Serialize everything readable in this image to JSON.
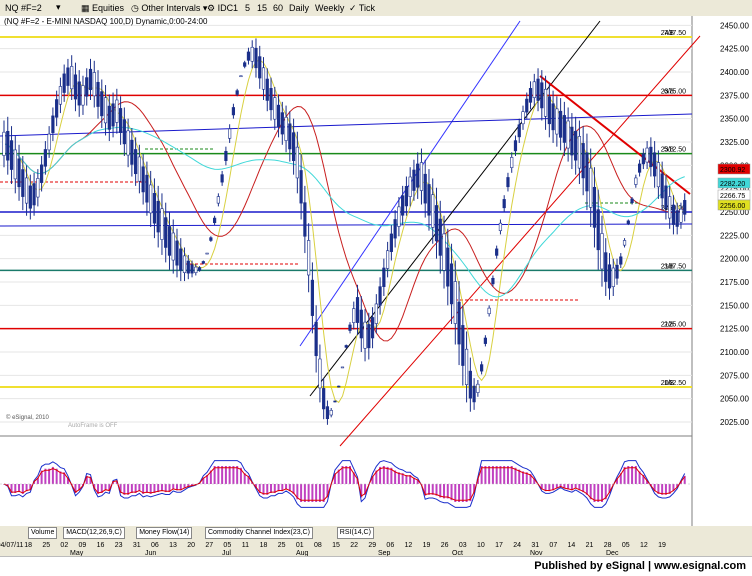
{
  "toolbar": {
    "symbol": "NQ #F=2",
    "equities": "Equities",
    "other_intervals": "Other Intervals",
    "idc": "IDC",
    "i1": "1",
    "i5": "5",
    "i15": "15",
    "i60": "60",
    "daily": "Daily",
    "weekly": "Weekly",
    "tick": "Tick"
  },
  "chart_title": "(NQ #F=2 - E-MINI NASDAQ 100,D) Dynamic,0:00-24:00",
  "watermarks": {
    "copyright": "© eSignal, 2010",
    "autoframe": "AutoFrame is OFF"
  },
  "footer": {
    "brand": "Published by eSignal | www.esignal.com"
  },
  "tabs": [
    "Volume",
    "MACD(12,26,9,C)",
    "Money Flow(14)",
    "Commodity Channel Index(23,C)",
    "RSI(14,C)"
  ],
  "colors": {
    "bg": "#ffffff",
    "candle": "#1a2f8a",
    "fib_red": "#e00000",
    "fib_yellow": "#f0e030",
    "fib_green": "#1a8a1a",
    "fib_blue": "#1a1acc",
    "fib_teal": "#1a7a6a",
    "ma_red": "#c81e1e",
    "ma_yellow": "#d8d040",
    "ma_cyan": "#40d8d8"
  },
  "chart_data": {
    "type": "candlestick",
    "title": "E-MINI NASDAQ 100",
    "y_ticks": [
      2025,
      2050,
      2075,
      2100,
      2125,
      2150,
      2175,
      2200,
      2225,
      2250,
      2275,
      2300,
      2325,
      2350,
      2375,
      2400,
      2425,
      2450
    ],
    "ylim": [
      2010,
      2460
    ],
    "fib_levels": [
      {
        "label": "7/8",
        "value": 2437.5,
        "color": "yellow"
      },
      {
        "label": "6/8",
        "value": 2375.0,
        "color": "red"
      },
      {
        "label": "5/8",
        "value": 2312.5,
        "color": "green"
      },
      {
        "label": "4/8",
        "value": 2250.0,
        "color": "blue"
      },
      {
        "label": "3/8",
        "value": 2187.5,
        "color": "teal"
      },
      {
        "label": "2/8",
        "value": 2125.0,
        "color": "red"
      },
      {
        "label": "1/8",
        "value": 2062.5,
        "color": "yellow"
      }
    ],
    "price_badges": [
      {
        "value": "2300.92",
        "color": "#e00000"
      },
      {
        "value": "2282.20",
        "color": "#40d8d8"
      },
      {
        "value": "2266.75",
        "color": "#ffffff"
      },
      {
        "value": "2256.00",
        "color": "#e0e020"
      }
    ],
    "x_labels": [
      "04/07/11",
      "18",
      "25",
      "02",
      "09",
      "16",
      "23",
      "31",
      "06",
      "13",
      "20",
      "27",
      "05",
      "11",
      "18",
      "25",
      "01",
      "08",
      "15",
      "22",
      "29",
      "06",
      "12",
      "19",
      "26",
      "03",
      "10",
      "17",
      "24",
      "31",
      "07",
      "14",
      "21",
      "28",
      "05",
      "12",
      "19"
    ],
    "month_labels": [
      "May",
      "Jun",
      "Jul",
      "Aug",
      "Sep",
      "Oct",
      "Nov",
      "Dec"
    ],
    "candles_high": [
      2348,
      2352,
      2342,
      2332,
      2322,
      2310,
      2300,
      2290,
      2292,
      2296,
      2310,
      2326,
      2342,
      2362,
      2380,
      2394,
      2408,
      2414,
      2418,
      2410,
      2402,
      2396,
      2404,
      2414,
      2412,
      2402,
      2392,
      2386,
      2376,
      2378,
      2382,
      2374,
      2362,
      2350,
      2340,
      2330,
      2322,
      2312,
      2304,
      2294,
      2286,
      2278,
      2270,
      2260,
      2250,
      2242,
      2232,
      2222,
      2212,
      2204,
      2198,
      2194,
      2192,
      2198,
      2206,
      2218,
      2236,
      2256,
      2278,
      2300,
      2324,
      2350,
      2374,
      2396,
      2412,
      2426,
      2434,
      2436,
      2428,
      2416,
      2404,
      2394,
      2384,
      2376,
      2368,
      2364,
      2358,
      2350,
      2336,
      2312,
      2278,
      2238,
      2196,
      2150,
      2108,
      2072,
      2048,
      2040,
      2048,
      2062,
      2084,
      2108,
      2132,
      2154,
      2172,
      2160,
      2146,
      2142,
      2148,
      2162,
      2180,
      2200,
      2218,
      2236,
      2252,
      2266,
      2278,
      2288,
      2298,
      2306,
      2314,
      2318,
      2306,
      2296,
      2286,
      2276,
      2262,
      2246,
      2232,
      2216,
      2198,
      2176,
      2150,
      2122,
      2094,
      2072,
      2070,
      2090,
      2118,
      2150,
      2182,
      2214,
      2242,
      2268,
      2292,
      2314,
      2332,
      2350,
      2364,
      2378,
      2390,
      2398,
      2404,
      2402,
      2396,
      2388,
      2380,
      2374,
      2372,
      2368,
      2362,
      2356,
      2352,
      2348,
      2342,
      2334,
      2318,
      2298,
      2274,
      2246,
      2222,
      2206,
      2200,
      2200,
      2206,
      2222,
      2242,
      2266,
      2290,
      2306,
      2318,
      2326,
      2330,
      2326,
      2316,
      2304,
      2290,
      2278,
      2268,
      2260,
      2260,
      2270
    ],
    "candles_low": [
      2298,
      2290,
      2280,
      2270,
      2262,
      2252,
      2246,
      2242,
      2246,
      2256,
      2272,
      2290,
      2308,
      2326,
      2342,
      2356,
      2368,
      2376,
      2370,
      2358,
      2352,
      2354,
      2364,
      2370,
      2362,
      2350,
      2340,
      2332,
      2326,
      2330,
      2334,
      2322,
      2310,
      2298,
      2288,
      2278,
      2270,
      2258,
      2246,
      2234,
      2222,
      2212,
      2204,
      2196,
      2188,
      2184,
      2180,
      2176,
      2176,
      2178,
      2180,
      2182,
      2186,
      2194,
      2206,
      2224,
      2246,
      2270,
      2294,
      2320,
      2344,
      2366,
      2382,
      2396,
      2404,
      2408,
      2404,
      2394,
      2382,
      2370,
      2358,
      2348,
      2338,
      2330,
      2322,
      2314,
      2304,
      2290,
      2270,
      2242,
      2206,
      2164,
      2120,
      2078,
      2046,
      2028,
      2022,
      2030,
      2046,
      2064,
      2084,
      2104,
      2120,
      2124,
      2118,
      2100,
      2090,
      2092,
      2104,
      2120,
      2140,
      2160,
      2180,
      2198,
      2212,
      2224,
      2236,
      2246,
      2256,
      2262,
      2264,
      2258,
      2244,
      2230,
      2216,
      2200,
      2184,
      2168,
      2150,
      2130,
      2108,
      2086,
      2064,
      2046,
      2036,
      2038,
      2052,
      2076,
      2106,
      2138,
      2170,
      2200,
      2226,
      2250,
      2272,
      2292,
      2310,
      2324,
      2338,
      2350,
      2360,
      2364,
      2358,
      2348,
      2338,
      2330,
      2324,
      2320,
      2316,
      2310,
      2304,
      2296,
      2290,
      2280,
      2268,
      2252,
      2234,
      2212,
      2188,
      2170,
      2160,
      2156,
      2160,
      2172,
      2190,
      2212,
      2236,
      2258,
      2276,
      2288,
      2296,
      2296,
      2288,
      2276,
      2264,
      2252,
      2242,
      2232,
      2226,
      2226,
      2232,
      2240
    ]
  }
}
